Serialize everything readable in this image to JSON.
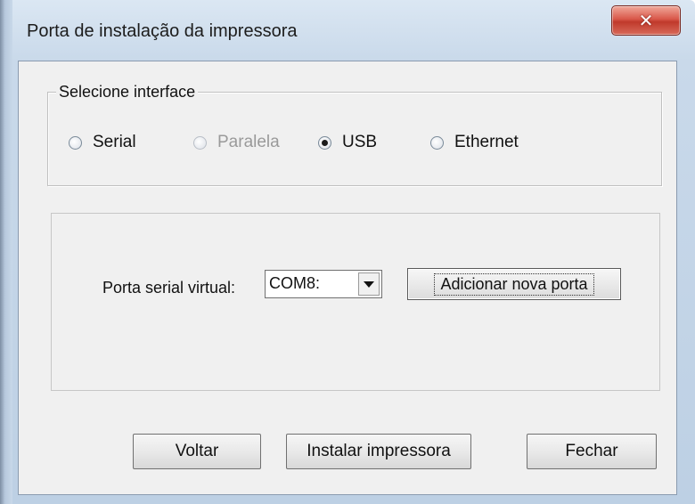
{
  "window": {
    "title": "Porta de instalação da impressora",
    "close_glyph": "✕"
  },
  "interface_group": {
    "legend": "Selecione interface",
    "options": [
      {
        "label": "Serial",
        "checked": false,
        "enabled": true
      },
      {
        "label": "Paralela",
        "checked": false,
        "enabled": false
      },
      {
        "label": "USB",
        "checked": true,
        "enabled": true
      },
      {
        "label": "Ethernet",
        "checked": false,
        "enabled": true
      }
    ]
  },
  "port_panel": {
    "label": "Porta serial virtual:",
    "selected_port": "COM8:",
    "add_button_label": "Adicionar nova porta"
  },
  "buttons": {
    "back_label": "Voltar",
    "install_label": "Instalar impressora",
    "close_label": "Fechar"
  }
}
